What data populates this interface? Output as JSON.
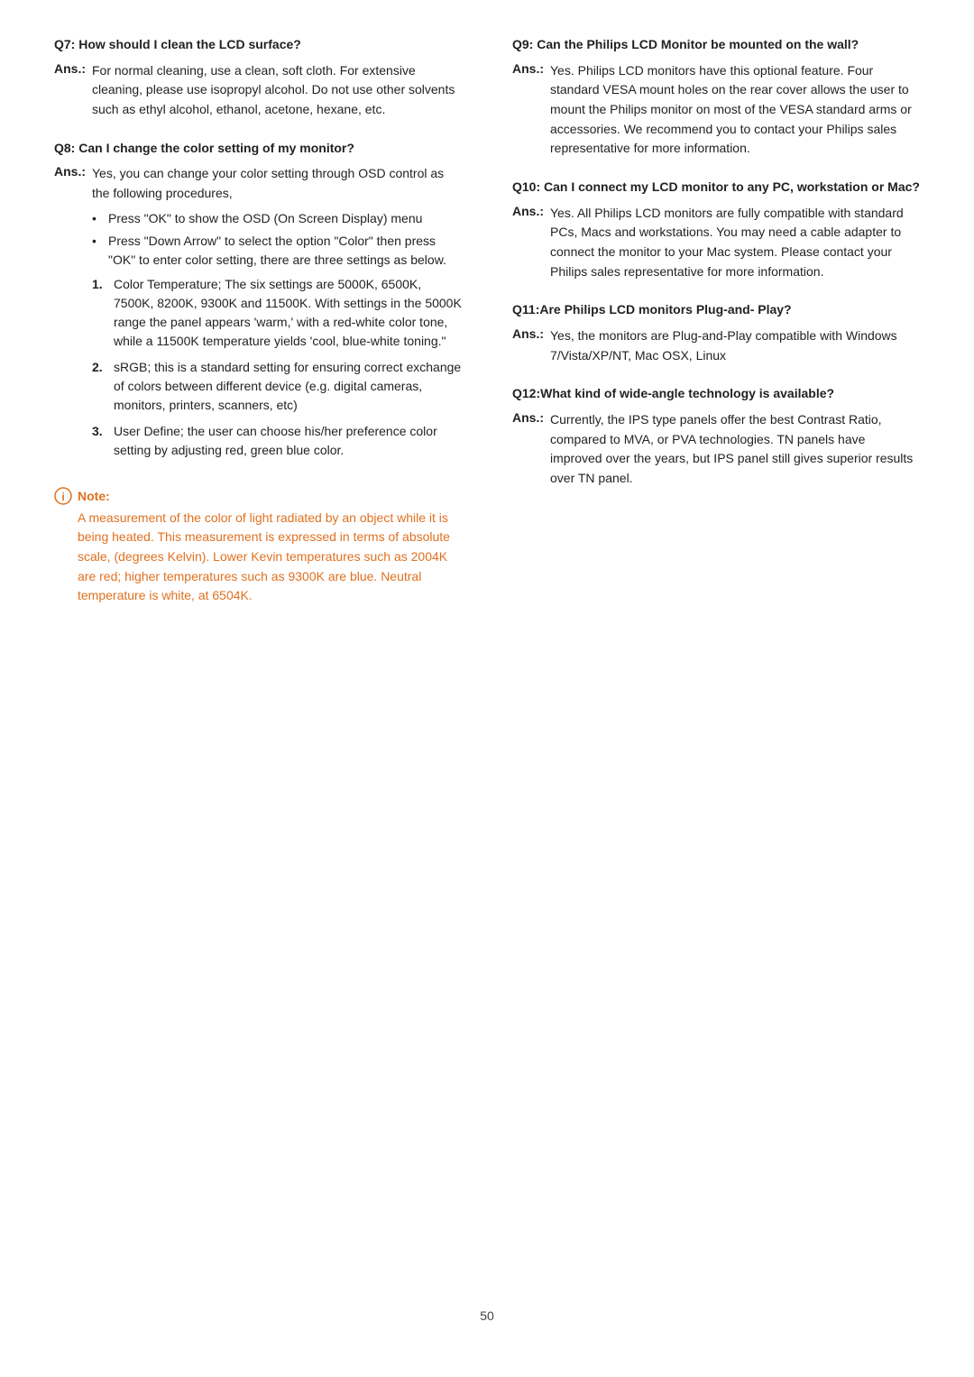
{
  "page": {
    "number": "50"
  },
  "left_col": {
    "qa": [
      {
        "id": "q7",
        "question_label": "Q7:",
        "question_text": " How should I clean the LCD surface?",
        "answer_label": "Ans.:",
        "answer_intro": "For normal cleaning, use a clean, soft cloth. For extensive cleaning, please use isopropyl alcohol. Do not use other solvents such as ethyl alcohol, ethanol, acetone, hexane, etc.",
        "bullets": [],
        "numbered": []
      },
      {
        "id": "q8",
        "question_label": "Q8:",
        "question_text": " Can I change the color setting of my monitor?",
        "answer_label": "Ans.:",
        "answer_intro": "Yes, you can change your color setting through OSD control as the following procedures,",
        "bullets": [
          "Press \"OK\" to show the OSD (On Screen Display) menu",
          "Press \"Down Arrow\" to select the option \"Color\" then press \"OK\" to enter color setting, there are three settings as below."
        ],
        "numbered": [
          "Color Temperature; The six settings are 5000K, 6500K, 7500K, 8200K, 9300K and 11500K. With settings in the 5000K range the panel appears 'warm,' with a red-white color tone, while a 11500K temperature yields 'cool, blue-white toning.\"",
          "sRGB; this is a standard setting for ensuring correct exchange of colors between different device (e.g. digital cameras, monitors, printers, scanners, etc)",
          "User Define; the user can choose his/her preference color setting by adjusting red, green blue color."
        ]
      }
    ],
    "note": {
      "label": "Note:",
      "text": "A measurement of the color of light radiated by an object while it is being heated. This measurement is expressed in terms of absolute scale, (degrees Kelvin). Lower Kevin temperatures such as 2004K are red; higher temperatures such as 9300K are blue. Neutral temperature is white, at 6504K."
    }
  },
  "right_col": {
    "qa": [
      {
        "id": "q9",
        "question_label": "Q9:",
        "question_text": " Can the Philips LCD Monitor be mounted on the wall?",
        "answer_label": "Ans.:",
        "answer_text": "Yes. Philips LCD monitors have this optional feature. Four standard VESA mount holes on the rear cover allows the user to mount the Philips monitor on most of the VESA standard arms or accessories. We recommend you to contact your Philips sales representative for more information."
      },
      {
        "id": "q10",
        "question_label": "Q10:",
        "question_text": " Can I connect my LCD monitor to any PC, workstation or Mac?",
        "answer_label": "Ans.:",
        "answer_text": "Yes. All Philips LCD monitors are fully compatible with standard PCs, Macs and workstations. You may need a cable adapter to connect the monitor to your Mac system. Please contact your Philips sales representative for more information."
      },
      {
        "id": "q11",
        "question_label": "Q11:",
        "question_text": "Are Philips LCD monitors Plug-and- Play?",
        "answer_label": "Ans.:",
        "answer_text": "Yes, the monitors are Plug-and-Play compatible with Windows 7/Vista/XP/NT, Mac OSX, Linux"
      },
      {
        "id": "q12",
        "question_label": "Q12:",
        "question_text": "What kind of wide-angle technology is available?",
        "answer_label": "Ans.:",
        "answer_text": "Currently, the IPS type panels offer the best Contrast Ratio, compared to MVA, or PVA technologies. TN panels have improved over the years, but IPS panel still gives superior results over TN panel."
      }
    ]
  }
}
